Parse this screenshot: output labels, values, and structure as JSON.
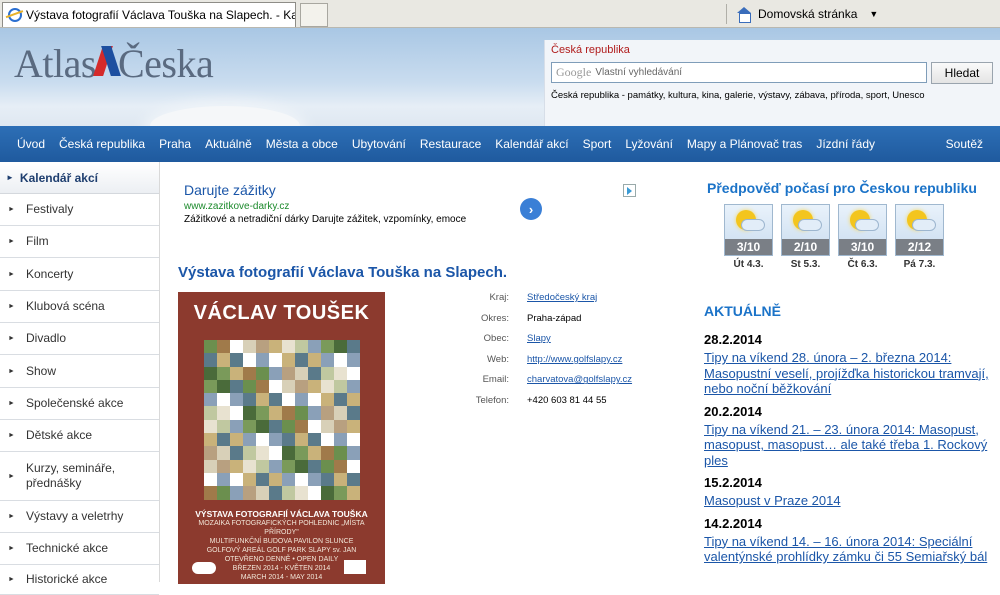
{
  "browser": {
    "tab_title": "Výstava fotografií Václava Touška na Slapech. - Kalen...",
    "home_label": "Domovská stránka"
  },
  "header": {
    "logo_left": "Atlas",
    "logo_right": "Česka",
    "search": {
      "title": "Česká republika",
      "brand": "Google",
      "placeholder": "Vlastní vyhledávání",
      "button": "Hledat",
      "tagline": "Česká republika - památky, kultura, kina, galerie, výstavy, zábava, příroda, sport, Unesco"
    }
  },
  "nav": {
    "items": [
      "Úvod",
      "Česká republika",
      "Praha",
      "Aktuálně",
      "Města a obce",
      "Ubytování",
      "Restaurace",
      "Kalendář akcí",
      "Sport",
      "Lyžování",
      "Mapy a Plánovač tras",
      "Jízdní řády"
    ],
    "right": "Soutěž"
  },
  "sidebar": {
    "heading": "Kalendář akcí",
    "items": [
      "Festivaly",
      "Film",
      "Koncerty",
      "Klubová scéna",
      "Divadlo",
      "Show",
      "Společenské akce",
      "Dětské akce",
      "Kurzy, semináře, přednášky",
      "Výstavy a veletrhy",
      "Technické akce",
      "Historické akce"
    ]
  },
  "ad": {
    "title": "Darujte zážitky",
    "url": "www.zazitkove-darky.cz",
    "desc": "Zážitkové a netradiční dárky Darujte zážitek, vzpomínky, emoce"
  },
  "event": {
    "title": "Výstava fotografií Václava Touška na Slapech.",
    "poster_name": "VÁCLAV TOUŠEK",
    "poster_lines": [
      "VÝSTAVA FOTOGRAFIÍ VÁCLAVA TOUŠKA",
      "MOZAIKA FOTOGRAFICKÝCH POHLEDNIC „MÍSTA PŘÍRODY\"",
      "MULTIFUNKČNÍ BUDOVA PAVILON SLUNCE",
      "GOLFOVÝ AREÁL GOLF PARK SLAPY sv. JAN",
      "OTEVŘENO DENNĚ • OPEN DAILY",
      "BŘEZEN 2014 - KVĚTEN 2014",
      "MARCH 2014 - MAY 2014"
    ],
    "info": [
      {
        "key": "Kraj:",
        "value": "Středočeský kraj",
        "link": true
      },
      {
        "key": "Okres:",
        "value": "Praha-západ",
        "link": false
      },
      {
        "key": "Obec:",
        "value": "Slapy",
        "link": true
      },
      {
        "key": "Web:",
        "value": "http://www.golfslapy.cz",
        "link": true
      },
      {
        "key": "Email:",
        "value": "charvatova@golfslapy.cz",
        "link": true
      },
      {
        "key": "Telefon:",
        "value": "+420 603 81 44 55",
        "link": false
      }
    ]
  },
  "weather": {
    "title": "Předpověď počasí pro Českou republiku",
    "days": [
      {
        "temp": "3/10",
        "label": "Út 4.3."
      },
      {
        "temp": "2/10",
        "label": "St 5.3."
      },
      {
        "temp": "3/10",
        "label": "Čt 6.3."
      },
      {
        "temp": "2/12",
        "label": "Pá 7.3."
      }
    ]
  },
  "news": {
    "heading": "AKTUÁLNĚ",
    "items": [
      {
        "date": "28.2.2014",
        "text": "Tipy na víkend 28. února – 2. března 2014: Masopustní veselí, projížďka historickou tramvají, nebo noční běžkování"
      },
      {
        "date": "20.2.2014",
        "text": "Tipy na víkend 21. – 23. února 2014: Masopust, masopust, masopust… ale také třeba 1. Rockový ples"
      },
      {
        "date": "15.2.2014",
        "text": "Masopust v Praze 2014"
      },
      {
        "date": "14.2.2014",
        "text": "Tipy na víkend 14. – 16. února 2014: Speciální valentýnské prohlídky zámku či 55 Semiařský bál"
      }
    ]
  }
}
